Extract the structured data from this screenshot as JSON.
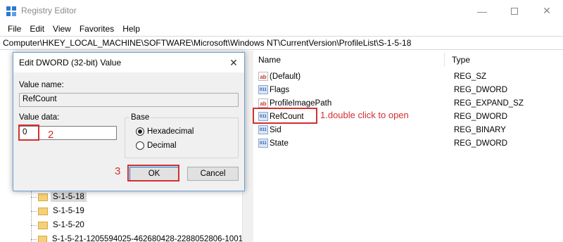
{
  "window": {
    "title": "Registry Editor"
  },
  "menu": [
    "File",
    "Edit",
    "View",
    "Favorites",
    "Help"
  ],
  "address": "Computer\\HKEY_LOCAL_MACHINE\\SOFTWARE\\Microsoft\\Windows NT\\CurrentVersion\\ProfileList\\S-1-5-18",
  "tree": {
    "items": [
      {
        "label": "S-1-5-18",
        "selected": true
      },
      {
        "label": "S-1-5-19"
      },
      {
        "label": "S-1-5-20"
      },
      {
        "label": "S-1-5-21-1205594025-462680428-2288052806-1001"
      }
    ]
  },
  "values": {
    "header": {
      "name": "Name",
      "type": "Type"
    },
    "rows": [
      {
        "name": "(Default)",
        "type": "REG_SZ",
        "icon": "string-value-icon"
      },
      {
        "name": "Flags",
        "type": "REG_DWORD",
        "icon": "dword-value-icon"
      },
      {
        "name": "ProfileImagePath",
        "type": "REG_EXPAND_SZ",
        "icon": "string-value-icon"
      },
      {
        "name": "RefCount",
        "type": "REG_DWORD",
        "icon": "dword-value-icon"
      },
      {
        "name": "Sid",
        "type": "REG_BINARY",
        "icon": "binary-value-icon"
      },
      {
        "name": "State",
        "type": "REG_DWORD",
        "icon": "dword-value-icon"
      }
    ]
  },
  "annotations": {
    "step1": "1.double click to open",
    "step2": "2",
    "step3": "3",
    "color": "#d32f2f"
  },
  "dialog": {
    "title": "Edit DWORD (32-bit) Value",
    "value_name_label": "Value name:",
    "value_name": "RefCount",
    "value_data_label": "Value data:",
    "value_data": "0",
    "base_label": "Base",
    "base_options": [
      {
        "label": "Hexadecimal",
        "checked": true
      },
      {
        "label": "Decimal",
        "checked": false
      }
    ],
    "ok_label": "OK",
    "cancel_label": "Cancel"
  }
}
